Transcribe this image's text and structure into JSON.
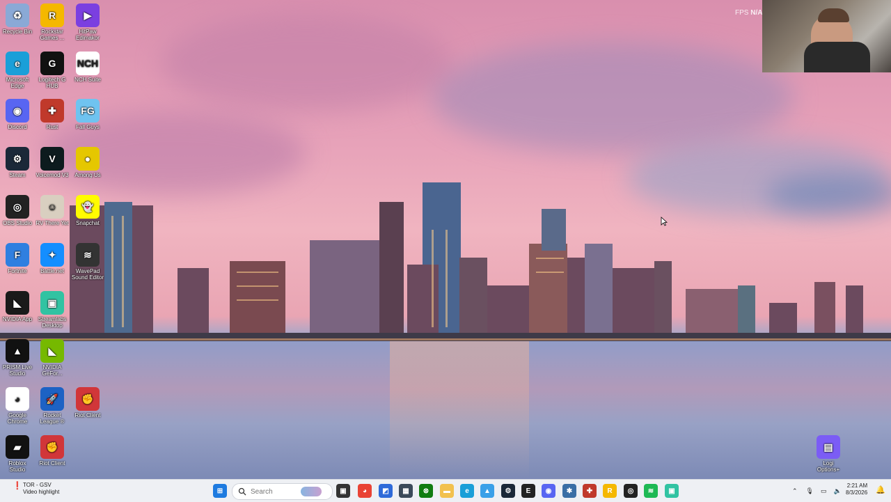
{
  "desktop": {
    "icons": [
      {
        "label": "Recycle Bin",
        "icon": "recycle-bin-icon",
        "color": "#8aa9d6",
        "glyph": "♻"
      },
      {
        "label": "Rockstar Games ...",
        "icon": "rockstar-icon",
        "color": "#f5b800",
        "glyph": "R"
      },
      {
        "label": "HitPaw Edimakor",
        "icon": "hitpaw-icon",
        "color": "#7b3fe0",
        "glyph": "▶"
      },
      {
        "label": "Microsoft Edge",
        "icon": "edge-icon",
        "color": "#1a9fd8",
        "glyph": "e"
      },
      {
        "label": "Logitech G HUB",
        "icon": "logitech-icon",
        "color": "#111111",
        "glyph": "G"
      },
      {
        "label": "NCH Suite",
        "icon": "nch-icon",
        "color": "#ffffff",
        "glyph": "NCH"
      },
      {
        "label": "Discord",
        "icon": "discord-icon",
        "color": "#5865f2",
        "glyph": "◉"
      },
      {
        "label": "Rust",
        "icon": "rust-icon",
        "color": "#c0392b",
        "glyph": "✚"
      },
      {
        "label": "Fall Guys",
        "icon": "fallguys-icon",
        "color": "#6fc3f0",
        "glyph": "FG"
      },
      {
        "label": "Steam",
        "icon": "steam-icon",
        "color": "#1b2838",
        "glyph": "⚙"
      },
      {
        "label": "Voicemod V3",
        "icon": "voicemod-icon",
        "color": "#0d1b1e",
        "glyph": "V"
      },
      {
        "label": "Among Us",
        "icon": "amongus-icon",
        "color": "#e5c700",
        "glyph": "●"
      },
      {
        "label": "OBS Studio",
        "icon": "obs-icon",
        "color": "#222222",
        "glyph": "◎"
      },
      {
        "label": "RV There Yet",
        "icon": "rv-icon",
        "color": "#d9cfc0",
        "glyph": "☺"
      },
      {
        "label": "Snapchat",
        "icon": "snapchat-icon",
        "color": "#fffc00",
        "glyph": "👻"
      },
      {
        "label": "Fortnite",
        "icon": "fortnite-icon",
        "color": "#2f7fe0",
        "glyph": "F"
      },
      {
        "label": "Battle.net",
        "icon": "battlenet-icon",
        "color": "#148eff",
        "glyph": "✦"
      },
      {
        "label": "WavePad Sound Editor",
        "icon": "wavepad-icon",
        "color": "#333333",
        "glyph": "≋"
      },
      {
        "label": "NVIDIA App",
        "icon": "nvidia-icon",
        "color": "#1a1a1a",
        "glyph": "◣"
      },
      {
        "label": "Streamlabs Desktop",
        "icon": "streamlabs-icon",
        "color": "#31c3a2",
        "glyph": "▣"
      },
      {
        "label": "PRISM Live Studio",
        "icon": "prism-icon",
        "color": "#111111",
        "glyph": "▲"
      },
      {
        "label": "NVIDIA GeFor...",
        "icon": "geforce-icon",
        "color": "#76b900",
        "glyph": "◣"
      },
      {
        "label": "Google Chrome",
        "icon": "chrome-icon",
        "color": "#ffffff",
        "glyph": "◕"
      },
      {
        "label": "Rocket League ®",
        "icon": "rocketleague-icon",
        "color": "#1d62c4",
        "glyph": "🚀"
      },
      {
        "label": "Riot Client",
        "icon": "riot-icon",
        "color": "#d13639",
        "glyph": "✊"
      },
      {
        "label": "Roblox Studio",
        "icon": "roblox-icon",
        "color": "#111111",
        "glyph": "▰"
      },
      {
        "label": "Riot Client",
        "icon": "riot-icon",
        "color": "#d13639",
        "glyph": "✊"
      }
    ],
    "logi_options": {
      "label": "Logi Options+",
      "icon": "logi-options-icon",
      "color": "#7b5cf5"
    }
  },
  "overlay": {
    "fps_label": "FPS",
    "fps_value": "N/A"
  },
  "notification": {
    "title": "TOR - GSV",
    "subtitle": "Video highlight"
  },
  "taskbar": {
    "search_placeholder": "Search",
    "apps": [
      {
        "name": "start-button",
        "icon": "windows-icon",
        "color": "#1e7be0"
      },
      {
        "name": "task-view",
        "icon": "task-view-icon",
        "color": "#333333"
      },
      {
        "name": "chrome",
        "icon": "chrome-icon",
        "color": "#e94335"
      },
      {
        "name": "app-blue",
        "icon": "app-icon",
        "color": "#2e6ad9"
      },
      {
        "name": "calculator",
        "icon": "calculator-icon",
        "color": "#3b4a5a"
      },
      {
        "name": "xbox",
        "icon": "xbox-icon",
        "color": "#107c10"
      },
      {
        "name": "file-explorer",
        "icon": "folder-icon",
        "color": "#f2c14e"
      },
      {
        "name": "edge",
        "icon": "edge-icon",
        "color": "#1a9fd8"
      },
      {
        "name": "photos",
        "icon": "photos-icon",
        "color": "#3aa0e8"
      },
      {
        "name": "steam",
        "icon": "steam-icon",
        "color": "#1b2838"
      },
      {
        "name": "epic-games",
        "icon": "epic-icon",
        "color": "#222222"
      },
      {
        "name": "discord",
        "icon": "discord-icon",
        "color": "#5865f2"
      },
      {
        "name": "app-gear",
        "icon": "gear-icon",
        "color": "#3a6ea5"
      },
      {
        "name": "rust",
        "icon": "rust-icon",
        "color": "#c0392b"
      },
      {
        "name": "rockstar",
        "icon": "rockstar-icon",
        "color": "#f5b800"
      },
      {
        "name": "obs",
        "icon": "obs-icon",
        "color": "#222222"
      },
      {
        "name": "spotify",
        "icon": "spotify-icon",
        "color": "#1db954"
      },
      {
        "name": "streamlabs",
        "icon": "streamlabs-icon",
        "color": "#31c3a2"
      }
    ]
  },
  "clock": {
    "time": "2:21 AM",
    "date": "8/3/2026"
  }
}
